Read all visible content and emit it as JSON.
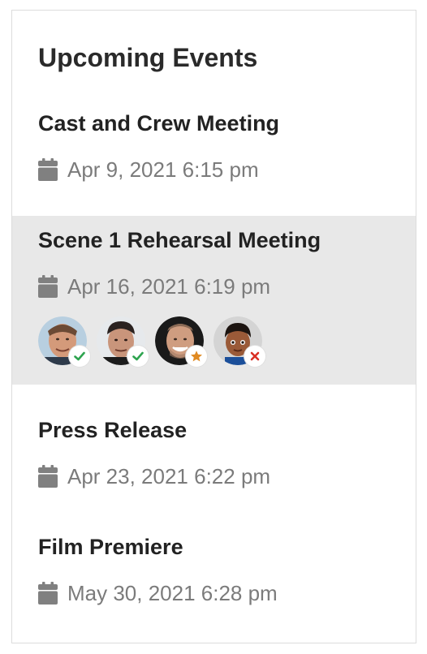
{
  "widget": {
    "title": "Upcoming Events"
  },
  "events": [
    {
      "title": "Cast and Crew Meeting",
      "date": "Apr 9, 2021 6:15 pm"
    },
    {
      "title": "Scene 1 Rehearsal Meeting",
      "date": "Apr 16, 2021 6:19 pm",
      "attendees": [
        {
          "icon": "avatar-person-1",
          "status": "accepted"
        },
        {
          "icon": "avatar-person-2",
          "status": "accepted"
        },
        {
          "icon": "avatar-person-3",
          "status": "host"
        },
        {
          "icon": "avatar-memoji-4",
          "status": "declined"
        }
      ]
    },
    {
      "title": "Press Release",
      "date": "Apr 23, 2021 6:22 pm"
    },
    {
      "title": "Film Premiere",
      "date": "May 30, 2021 6:28 pm"
    }
  ],
  "colors": {
    "highlight_row": "#e8e8e8",
    "date_text": "#7b7b7b",
    "calendar_icon": "#808080",
    "accepted": "#2ea44f",
    "host": "#e08a22",
    "declined": "#d93025"
  }
}
